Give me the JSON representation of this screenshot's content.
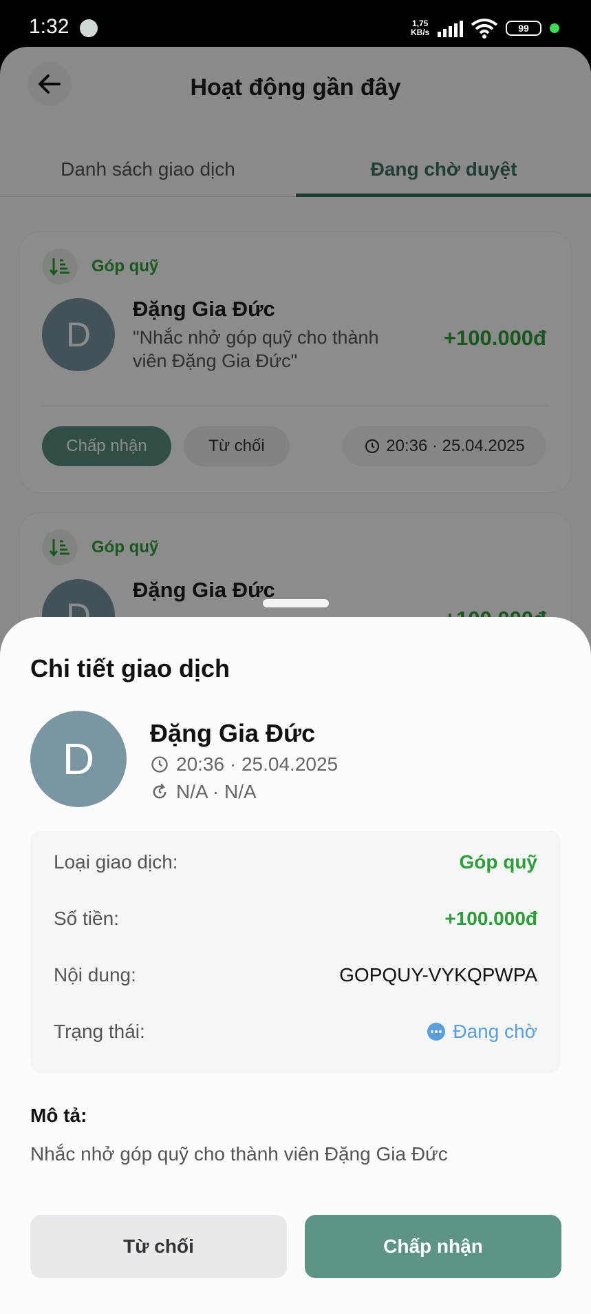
{
  "status_bar": {
    "time": "1:32",
    "net_speed_value": "1,75",
    "net_speed_unit": "KB/s",
    "battery": "99"
  },
  "header": {
    "title": "Hoạt động gần đây"
  },
  "tabs": [
    {
      "label": "Danh sách giao dịch"
    },
    {
      "label": "Đang chờ duyệt"
    }
  ],
  "cards": [
    {
      "tag": "Góp quỹ",
      "avatar_letter": "D",
      "name": "Đặng Gia Đức",
      "description": "\"Nhắc nhở góp quỹ cho thành viên Đặng Gia Đức\"",
      "amount": "+100.000đ",
      "accept_label": "Chấp nhận",
      "reject_label": "Từ chối",
      "time": "20:36 · 25.04.2025"
    },
    {
      "tag": "Góp quỹ",
      "avatar_letter": "D",
      "name": "Đặng Gia Đức",
      "amount": "+100.000đ"
    }
  ],
  "sheet": {
    "title": "Chi tiết giao dịch",
    "avatar_letter": "D",
    "name": "Đặng Gia Đức",
    "time": "20:36 · 25.04.2025",
    "recurring": "N/A · N/A",
    "rows": [
      {
        "label": "Loại giao dịch:",
        "value": "Góp quỹ"
      },
      {
        "label": "Số tiền:",
        "value": "+100.000đ"
      },
      {
        "label": "Nội dung:",
        "value": "GOPQUY-VYKQPWPA"
      },
      {
        "label": "Trạng thái:",
        "value": "Đang chờ"
      }
    ],
    "description_label": "Mô tả:",
    "description": "Nhắc nhở góp quỹ cho thành viên Đặng Gia Đức",
    "reject_label": "Từ chối",
    "accept_label": "Chấp nhận"
  },
  "colors": {
    "accent": "#5e9387",
    "income_green": "#2e9e3a",
    "pending_blue": "#5b9ee0",
    "avatar": "#7a96a2"
  }
}
